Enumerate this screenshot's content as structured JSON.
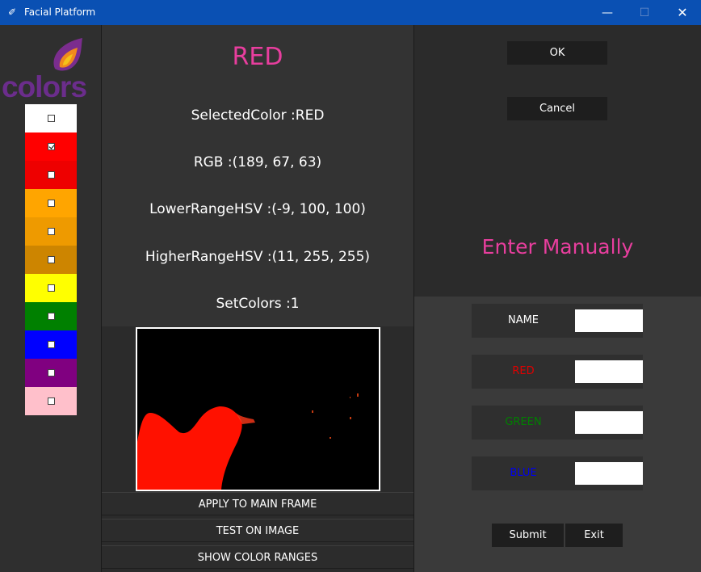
{
  "window": {
    "title": "Facial Platform",
    "minimize": "—",
    "maximize": "☐",
    "close": "✕"
  },
  "logo": {
    "text": "colors"
  },
  "swatches": [
    {
      "color": "#ffffff",
      "checked": false
    },
    {
      "color": "#ff0000",
      "checked": true
    },
    {
      "color": "#ee0000",
      "checked": false
    },
    {
      "color": "#ffa500",
      "checked": false
    },
    {
      "color": "#ee9a00",
      "checked": false
    },
    {
      "color": "#cd8500",
      "checked": false
    },
    {
      "color": "#ffff00",
      "checked": false
    },
    {
      "color": "#008000",
      "checked": false
    },
    {
      "color": "#0000ff",
      "checked": false
    },
    {
      "color": "#800080",
      "checked": false
    },
    {
      "color": "#ffc0cb",
      "checked": false
    }
  ],
  "info": {
    "title": "RED",
    "selected_color": "SelectedColor :RED",
    "rgb": "RGB :(189, 67, 63)",
    "lower_range": "LowerRangeHSV :(-9, 100, 100)",
    "higher_range": "HigherRangeHSV :(11, 255, 255)",
    "set_colors": "SetColors :1"
  },
  "actions": {
    "apply": "APPLY TO MAIN FRAME",
    "test": "TEST ON IMAGE",
    "show_ranges": "SHOW COLOR RANGES"
  },
  "dialog": {
    "ok": "OK",
    "cancel": "Cancel"
  },
  "manual": {
    "title": "Enter Manually",
    "fields": [
      {
        "label": "NAME",
        "color": "#ffffff",
        "value": ""
      },
      {
        "label": "RED",
        "color": "#e00000",
        "value": ""
      },
      {
        "label": "GREEN",
        "color": "#008000",
        "value": ""
      },
      {
        "label": "BLUE",
        "color": "#0000ee",
        "value": ""
      }
    ],
    "submit": "Submit",
    "exit": "Exit"
  },
  "colors": {
    "title_bar": "#0a50b3",
    "accent_pink": "#e83e9e",
    "mask_red": "#ff1100"
  }
}
